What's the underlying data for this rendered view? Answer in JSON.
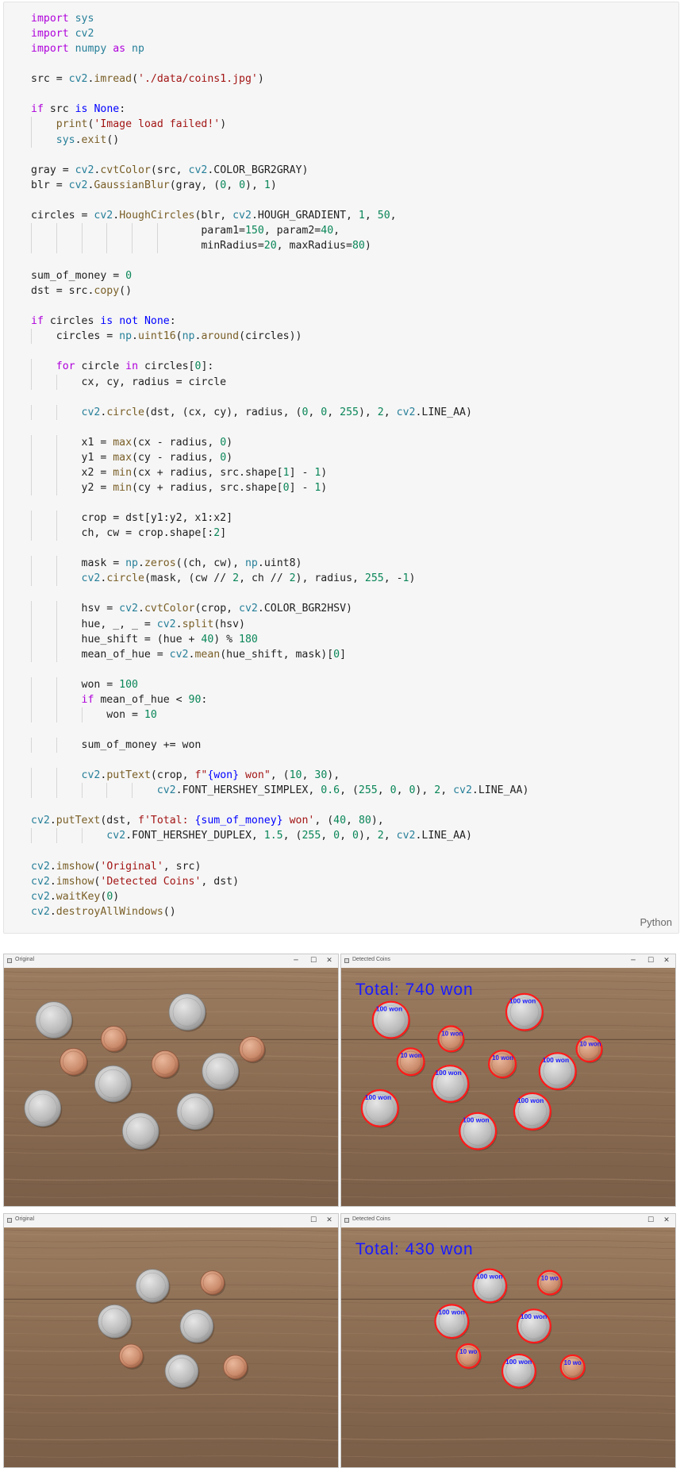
{
  "code_block": {
    "language": "Python",
    "lines": [
      [
        {
          "t": "import",
          "c": "kw"
        },
        {
          "t": " sys",
          "c": "md"
        }
      ],
      [
        {
          "t": "import",
          "c": "kw"
        },
        {
          "t": " cv2",
          "c": "md"
        }
      ],
      [
        {
          "t": "import",
          "c": "kw"
        },
        {
          "t": " numpy ",
          "c": "md"
        },
        {
          "t": "as",
          "c": "kw"
        },
        {
          "t": " np",
          "c": "md"
        }
      ],
      [],
      [
        {
          "t": "src = "
        },
        {
          "t": "cv2",
          "c": "md"
        },
        {
          "t": "."
        },
        {
          "t": "imread",
          "c": "fn"
        },
        {
          "t": "("
        },
        {
          "t": "'./data/coins1.jpg'",
          "c": "str"
        },
        {
          "t": ")"
        }
      ],
      [],
      [
        {
          "t": "if",
          "c": "kw"
        },
        {
          "t": " src "
        },
        {
          "t": "is",
          "c": "kw2"
        },
        {
          "t": " "
        },
        {
          "t": "None",
          "c": "kw2"
        },
        {
          "t": ":"
        }
      ],
      [
        {
          "t": "    "
        },
        {
          "t": "print",
          "c": "fn"
        },
        {
          "t": "("
        },
        {
          "t": "'Image load failed!'",
          "c": "str"
        },
        {
          "t": ")"
        }
      ],
      [
        {
          "t": "    "
        },
        {
          "t": "sys",
          "c": "md"
        },
        {
          "t": "."
        },
        {
          "t": "exit",
          "c": "fn"
        },
        {
          "t": "()"
        }
      ],
      [],
      [
        {
          "t": "gray = "
        },
        {
          "t": "cv2",
          "c": "md"
        },
        {
          "t": "."
        },
        {
          "t": "cvtColor",
          "c": "fn"
        },
        {
          "t": "(src, "
        },
        {
          "t": "cv2",
          "c": "md"
        },
        {
          "t": ".COLOR_BGR2GRAY)"
        }
      ],
      [
        {
          "t": "blr = "
        },
        {
          "t": "cv2",
          "c": "md"
        },
        {
          "t": "."
        },
        {
          "t": "GaussianBlur",
          "c": "fn"
        },
        {
          "t": "(gray, ("
        },
        {
          "t": "0",
          "c": "num"
        },
        {
          "t": ", "
        },
        {
          "t": "0",
          "c": "num"
        },
        {
          "t": "), "
        },
        {
          "t": "1",
          "c": "num"
        },
        {
          "t": ")"
        }
      ],
      [],
      [
        {
          "t": "circles = "
        },
        {
          "t": "cv2",
          "c": "md"
        },
        {
          "t": "."
        },
        {
          "t": "HoughCircles",
          "c": "fn"
        },
        {
          "t": "(blr, "
        },
        {
          "t": "cv2",
          "c": "md"
        },
        {
          "t": ".HOUGH_GRADIENT, "
        },
        {
          "t": "1",
          "c": "num"
        },
        {
          "t": ", "
        },
        {
          "t": "50",
          "c": "num"
        },
        {
          "t": ","
        }
      ],
      [
        {
          "t": "                           param1="
        },
        {
          "t": "150",
          "c": "num"
        },
        {
          "t": ", param2="
        },
        {
          "t": "40",
          "c": "num"
        },
        {
          "t": ","
        }
      ],
      [
        {
          "t": "                           minRadius="
        },
        {
          "t": "20",
          "c": "num"
        },
        {
          "t": ", maxRadius="
        },
        {
          "t": "80",
          "c": "num"
        },
        {
          "t": ")"
        }
      ],
      [],
      [
        {
          "t": "sum_of_money = "
        },
        {
          "t": "0",
          "c": "num"
        }
      ],
      [
        {
          "t": "dst = src."
        },
        {
          "t": "copy",
          "c": "fn"
        },
        {
          "t": "()"
        }
      ],
      [],
      [
        {
          "t": "if",
          "c": "kw"
        },
        {
          "t": " circles "
        },
        {
          "t": "is",
          "c": "kw2"
        },
        {
          "t": " "
        },
        {
          "t": "not",
          "c": "kw2"
        },
        {
          "t": " "
        },
        {
          "t": "None",
          "c": "kw2"
        },
        {
          "t": ":"
        }
      ],
      [
        {
          "t": "    circles = "
        },
        {
          "t": "np",
          "c": "md"
        },
        {
          "t": "."
        },
        {
          "t": "uint16",
          "c": "fn"
        },
        {
          "t": "("
        },
        {
          "t": "np",
          "c": "md"
        },
        {
          "t": "."
        },
        {
          "t": "around",
          "c": "fn"
        },
        {
          "t": "(circles))"
        }
      ],
      [],
      [
        {
          "t": "    "
        },
        {
          "t": "for",
          "c": "kw"
        },
        {
          "t": " circle "
        },
        {
          "t": "in",
          "c": "kw"
        },
        {
          "t": " circles["
        },
        {
          "t": "0",
          "c": "num"
        },
        {
          "t": "]:"
        }
      ],
      [
        {
          "t": "        cx, cy, radius = circle"
        }
      ],
      [],
      [
        {
          "t": "        "
        },
        {
          "t": "cv2",
          "c": "md"
        },
        {
          "t": "."
        },
        {
          "t": "circle",
          "c": "fn"
        },
        {
          "t": "(dst, (cx, cy), radius, ("
        },
        {
          "t": "0",
          "c": "num"
        },
        {
          "t": ", "
        },
        {
          "t": "0",
          "c": "num"
        },
        {
          "t": ", "
        },
        {
          "t": "255",
          "c": "num"
        },
        {
          "t": "), "
        },
        {
          "t": "2",
          "c": "num"
        },
        {
          "t": ", "
        },
        {
          "t": "cv2",
          "c": "md"
        },
        {
          "t": ".LINE_AA)"
        }
      ],
      [],
      [
        {
          "t": "        x1 = "
        },
        {
          "t": "max",
          "c": "fn"
        },
        {
          "t": "(cx - radius, "
        },
        {
          "t": "0",
          "c": "num"
        },
        {
          "t": ")"
        }
      ],
      [
        {
          "t": "        y1 = "
        },
        {
          "t": "max",
          "c": "fn"
        },
        {
          "t": "(cy - radius, "
        },
        {
          "t": "0",
          "c": "num"
        },
        {
          "t": ")"
        }
      ],
      [
        {
          "t": "        x2 = "
        },
        {
          "t": "min",
          "c": "fn"
        },
        {
          "t": "(cx + radius, src.shape["
        },
        {
          "t": "1",
          "c": "num"
        },
        {
          "t": "] - "
        },
        {
          "t": "1",
          "c": "num"
        },
        {
          "t": ")"
        }
      ],
      [
        {
          "t": "        y2 = "
        },
        {
          "t": "min",
          "c": "fn"
        },
        {
          "t": "(cy + radius, src.shape["
        },
        {
          "t": "0",
          "c": "num"
        },
        {
          "t": "] - "
        },
        {
          "t": "1",
          "c": "num"
        },
        {
          "t": ")"
        }
      ],
      [],
      [
        {
          "t": "        crop = dst[y1:y2, x1:x2]"
        }
      ],
      [
        {
          "t": "        ch, cw = crop.shape[:"
        },
        {
          "t": "2",
          "c": "num"
        },
        {
          "t": "]"
        }
      ],
      [],
      [
        {
          "t": "        mask = "
        },
        {
          "t": "np",
          "c": "md"
        },
        {
          "t": "."
        },
        {
          "t": "zeros",
          "c": "fn"
        },
        {
          "t": "((ch, cw), "
        },
        {
          "t": "np",
          "c": "md"
        },
        {
          "t": ".uint8)"
        }
      ],
      [
        {
          "t": "        "
        },
        {
          "t": "cv2",
          "c": "md"
        },
        {
          "t": "."
        },
        {
          "t": "circle",
          "c": "fn"
        },
        {
          "t": "(mask, (cw // "
        },
        {
          "t": "2",
          "c": "num"
        },
        {
          "t": ", ch // "
        },
        {
          "t": "2",
          "c": "num"
        },
        {
          "t": "), radius, "
        },
        {
          "t": "255",
          "c": "num"
        },
        {
          "t": ", -"
        },
        {
          "t": "1",
          "c": "num"
        },
        {
          "t": ")"
        }
      ],
      [],
      [
        {
          "t": "        hsv = "
        },
        {
          "t": "cv2",
          "c": "md"
        },
        {
          "t": "."
        },
        {
          "t": "cvtColor",
          "c": "fn"
        },
        {
          "t": "(crop, "
        },
        {
          "t": "cv2",
          "c": "md"
        },
        {
          "t": ".COLOR_BGR2HSV)"
        }
      ],
      [
        {
          "t": "        hue, _, _ = "
        },
        {
          "t": "cv2",
          "c": "md"
        },
        {
          "t": "."
        },
        {
          "t": "split",
          "c": "fn"
        },
        {
          "t": "(hsv)"
        }
      ],
      [
        {
          "t": "        hue_shift = (hue + "
        },
        {
          "t": "40",
          "c": "num"
        },
        {
          "t": ") % "
        },
        {
          "t": "180",
          "c": "num"
        }
      ],
      [
        {
          "t": "        mean_of_hue = "
        },
        {
          "t": "cv2",
          "c": "md"
        },
        {
          "t": "."
        },
        {
          "t": "mean",
          "c": "fn"
        },
        {
          "t": "(hue_shift, mask)["
        },
        {
          "t": "0",
          "c": "num"
        },
        {
          "t": "]"
        }
      ],
      [],
      [
        {
          "t": "        won = "
        },
        {
          "t": "100",
          "c": "num"
        }
      ],
      [
        {
          "t": "        "
        },
        {
          "t": "if",
          "c": "kw"
        },
        {
          "t": " mean_of_hue < "
        },
        {
          "t": "90",
          "c": "num"
        },
        {
          "t": ":"
        }
      ],
      [
        {
          "t": "            won = "
        },
        {
          "t": "10",
          "c": "num"
        }
      ],
      [],
      [
        {
          "t": "        sum_of_money += won"
        }
      ],
      [],
      [
        {
          "t": "        "
        },
        {
          "t": "cv2",
          "c": "md"
        },
        {
          "t": "."
        },
        {
          "t": "putText",
          "c": "fn"
        },
        {
          "t": "(crop, "
        },
        {
          "t": "f\"",
          "c": "str"
        },
        {
          "t": "{won}",
          "c": "kw2"
        },
        {
          "t": " won\"",
          "c": "str"
        },
        {
          "t": ", ("
        },
        {
          "t": "10",
          "c": "num"
        },
        {
          "t": ", "
        },
        {
          "t": "30",
          "c": "num"
        },
        {
          "t": "),"
        }
      ],
      [
        {
          "t": "                    "
        },
        {
          "t": "cv2",
          "c": "md"
        },
        {
          "t": ".FONT_HERSHEY_SIMPLEX, "
        },
        {
          "t": "0.6",
          "c": "num"
        },
        {
          "t": ", ("
        },
        {
          "t": "255",
          "c": "num"
        },
        {
          "t": ", "
        },
        {
          "t": "0",
          "c": "num"
        },
        {
          "t": ", "
        },
        {
          "t": "0",
          "c": "num"
        },
        {
          "t": "), "
        },
        {
          "t": "2",
          "c": "num"
        },
        {
          "t": ", "
        },
        {
          "t": "cv2",
          "c": "md"
        },
        {
          "t": ".LINE_AA)"
        }
      ],
      [],
      [
        {
          "t": "cv2",
          "c": "md"
        },
        {
          "t": "."
        },
        {
          "t": "putText",
          "c": "fn"
        },
        {
          "t": "(dst, "
        },
        {
          "t": "f'Total: ",
          "c": "str"
        },
        {
          "t": "{sum_of_money}",
          "c": "kw2"
        },
        {
          "t": " won'",
          "c": "str"
        },
        {
          "t": ", ("
        },
        {
          "t": "40",
          "c": "num"
        },
        {
          "t": ", "
        },
        {
          "t": "80",
          "c": "num"
        },
        {
          "t": "),"
        }
      ],
      [
        {
          "t": "            "
        },
        {
          "t": "cv2",
          "c": "md"
        },
        {
          "t": ".FONT_HERSHEY_DUPLEX, "
        },
        {
          "t": "1.5",
          "c": "num"
        },
        {
          "t": ", ("
        },
        {
          "t": "255",
          "c": "num"
        },
        {
          "t": ", "
        },
        {
          "t": "0",
          "c": "num"
        },
        {
          "t": ", "
        },
        {
          "t": "0",
          "c": "num"
        },
        {
          "t": "), "
        },
        {
          "t": "2",
          "c": "num"
        },
        {
          "t": ", "
        },
        {
          "t": "cv2",
          "c": "md"
        },
        {
          "t": ".LINE_AA)"
        }
      ],
      [],
      [
        {
          "t": "cv2",
          "c": "md"
        },
        {
          "t": "."
        },
        {
          "t": "imshow",
          "c": "fn"
        },
        {
          "t": "("
        },
        {
          "t": "'Original'",
          "c": "str"
        },
        {
          "t": ", src)"
        }
      ],
      [
        {
          "t": "cv2",
          "c": "md"
        },
        {
          "t": "."
        },
        {
          "t": "imshow",
          "c": "fn"
        },
        {
          "t": "("
        },
        {
          "t": "'Detected Coins'",
          "c": "str"
        },
        {
          "t": ", dst)"
        }
      ],
      [
        {
          "t": "cv2",
          "c": "md"
        },
        {
          "t": "."
        },
        {
          "t": "waitKey",
          "c": "fn"
        },
        {
          "t": "("
        },
        {
          "t": "0",
          "c": "num"
        },
        {
          "t": ")"
        }
      ],
      [
        {
          "t": "cv2",
          "c": "md"
        },
        {
          "t": "."
        },
        {
          "t": "destroyAllWindows",
          "c": "fn"
        },
        {
          "t": "()"
        }
      ]
    ]
  },
  "windows": [
    {
      "title": "Original",
      "type": "original",
      "coins": [
        {
          "kind": "100",
          "label": ""
        },
        {
          "kind": "100",
          "label": ""
        },
        {
          "kind": "10",
          "label": ""
        },
        {
          "kind": "10",
          "label": ""
        },
        {
          "kind": "10",
          "label": ""
        },
        {
          "kind": "10",
          "label": ""
        },
        {
          "kind": "100",
          "label": ""
        },
        {
          "kind": "100",
          "label": ""
        },
        {
          "kind": "100",
          "label": ""
        },
        {
          "kind": "100",
          "label": ""
        },
        {
          "kind": "100",
          "label": ""
        }
      ]
    },
    {
      "title": "Detected Coins",
      "type": "detected",
      "total_text": "Total: 740 won",
      "coins": [
        {
          "kind": "100",
          "label": "100 won"
        },
        {
          "kind": "100",
          "label": "100 won"
        },
        {
          "kind": "10",
          "label": "10 won"
        },
        {
          "kind": "10",
          "label": "10 won"
        },
        {
          "kind": "10",
          "label": "10 won"
        },
        {
          "kind": "10",
          "label": "10 won"
        },
        {
          "kind": "100",
          "label": "100 won"
        },
        {
          "kind": "100",
          "label": "100 won"
        },
        {
          "kind": "100",
          "label": "100 won"
        },
        {
          "kind": "100",
          "label": "100 won"
        },
        {
          "kind": "100",
          "label": "100 won"
        }
      ]
    },
    {
      "title": "Original",
      "type": "original",
      "coins": [
        {
          "kind": "100",
          "label": ""
        },
        {
          "kind": "10",
          "label": ""
        },
        {
          "kind": "100",
          "label": ""
        },
        {
          "kind": "100",
          "label": ""
        },
        {
          "kind": "10",
          "label": ""
        },
        {
          "kind": "100",
          "label": ""
        },
        {
          "kind": "10",
          "label": ""
        }
      ]
    },
    {
      "title": "Detected Coins",
      "type": "detected",
      "total_text": "Total: 430 won",
      "coins": [
        {
          "kind": "100",
          "label": "100 won"
        },
        {
          "kind": "10",
          "label": "10 wo"
        },
        {
          "kind": "100",
          "label": "100 won"
        },
        {
          "kind": "100",
          "label": "100 won"
        },
        {
          "kind": "10",
          "label": "10 wo"
        },
        {
          "kind": "100",
          "label": "100 won"
        },
        {
          "kind": "10",
          "label": "10 wo"
        }
      ]
    }
  ],
  "colors": {
    "wood_base": "#8a6c52",
    "detection_circle": "#ff1a1a",
    "label_text": "#1a1aff",
    "silver_coin": "#b8b8b8",
    "bronze_coin": "#c98a6a"
  }
}
